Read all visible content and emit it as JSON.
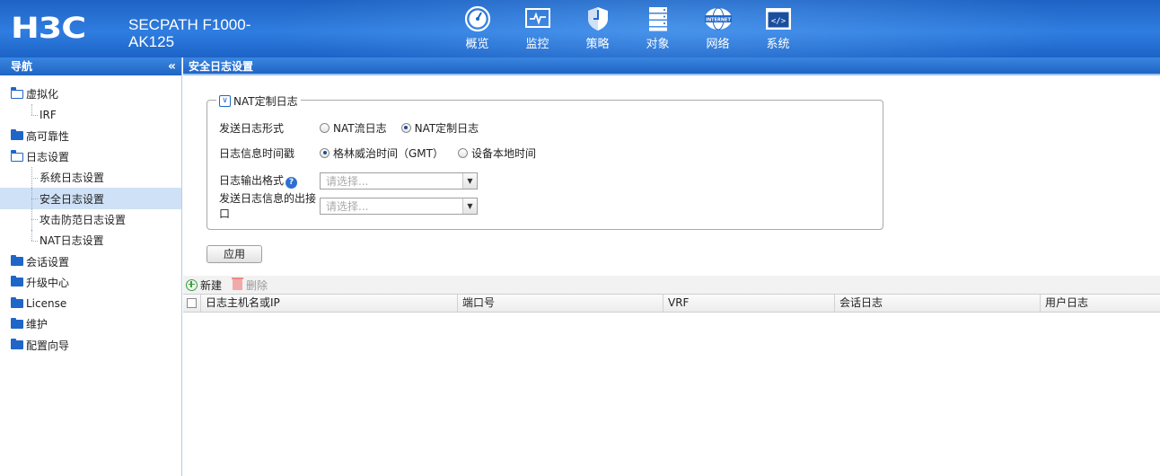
{
  "header": {
    "logo": "H3C",
    "product_line1": "SECPATH F1000-",
    "product_line2": "AK125",
    "nav": [
      {
        "label": "概览",
        "icon": "gauge-icon"
      },
      {
        "label": "监控",
        "icon": "monitor-icon"
      },
      {
        "label": "策略",
        "icon": "shield-icon"
      },
      {
        "label": "对象",
        "icon": "server-rack-icon"
      },
      {
        "label": "网络",
        "icon": "internet-globe-icon"
      },
      {
        "label": "系统",
        "icon": "code-window-icon"
      }
    ],
    "internet_badge": "INTERNET"
  },
  "sidebar": {
    "title": "导航",
    "collapse": "«",
    "items": [
      {
        "label": "虚拟化"
      },
      {
        "label": "IRF"
      },
      {
        "label": "高可靠性"
      },
      {
        "label": "日志设置"
      },
      {
        "label": "系统日志设置"
      },
      {
        "label": "安全日志设置"
      },
      {
        "label": "攻击防范日志设置"
      },
      {
        "label": "NAT日志设置"
      },
      {
        "label": "会话设置"
      },
      {
        "label": "升级中心"
      },
      {
        "label": "License"
      },
      {
        "label": "维护"
      },
      {
        "label": "配置向导"
      }
    ]
  },
  "main": {
    "title": "安全日志设置",
    "section": {
      "title": "NAT定制日志",
      "toggle": "∨",
      "rows": {
        "send_format": {
          "label": "发送日志形式",
          "options": [
            "NAT流日志",
            "NAT定制日志"
          ],
          "selected": "NAT定制日志"
        },
        "timestamp": {
          "label": "日志信息时间戳",
          "options": [
            "格林威治时间（GMT）",
            "设备本地时间"
          ],
          "selected": "格林威治时间（GMT）"
        },
        "output_format": {
          "label": "日志输出格式",
          "help": "?",
          "placeholder": "请选择..."
        },
        "egress": {
          "label": "发送日志信息的出接口",
          "placeholder": "请选择..."
        }
      }
    },
    "apply_label": "应用",
    "toolbar": {
      "new_label": "新建",
      "delete_label": "删除"
    },
    "table": {
      "columns": [
        "日志主机名或IP",
        "端口号",
        "VRF",
        "会话日志",
        "用户日志"
      ],
      "rows": []
    }
  }
}
